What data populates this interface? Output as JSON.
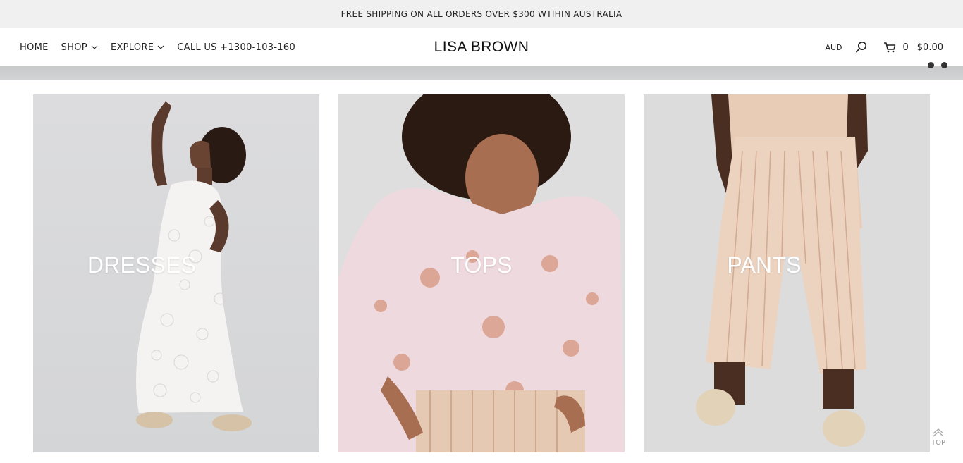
{
  "announcement": "FREE SHIPPING ON ALL ORDERS OVER $300 WTIHIN AUSTRALIA",
  "nav": {
    "home": "HOME",
    "shop": "SHOP",
    "explore": "EXPLORE",
    "call": "CALL US +1300-103-160"
  },
  "brand": "LISA BROWN",
  "header_right": {
    "currency": "AUD",
    "cart_count": "0",
    "cart_total": "$0.00"
  },
  "categories": [
    {
      "label": "DRESSES"
    },
    {
      "label": "TOPS"
    },
    {
      "label": "PANTS"
    }
  ],
  "back_to_top": "TOP",
  "icons": {
    "search": "search-icon",
    "cart": "cart-icon",
    "chevron": "chevron-down-icon",
    "back_to_top": "chevron-up-icon"
  },
  "colors": {
    "announcement_bg": "#f0f0f0",
    "text": "#222222",
    "tile_bg": "#dcdddf",
    "label": "#ffffff"
  }
}
